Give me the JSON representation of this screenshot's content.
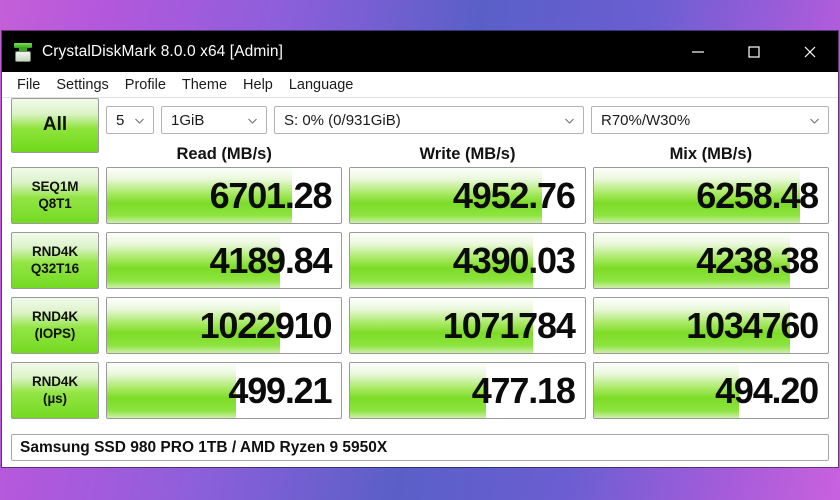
{
  "window": {
    "title": "CrystalDiskMark 8.0.0 x64 [Admin]",
    "icon": "crystaldiskmark-icon",
    "controls": {
      "minimize": "minimize-icon",
      "maximize": "maximize-icon",
      "close": "close-icon"
    }
  },
  "menubar": {
    "items": [
      {
        "label": "File"
      },
      {
        "label": "Settings"
      },
      {
        "label": "Profile"
      },
      {
        "label": "Theme"
      },
      {
        "label": "Help"
      },
      {
        "label": "Language"
      }
    ]
  },
  "toolbar": {
    "all_button": "All",
    "test_count": "5",
    "test_size": "1GiB",
    "drive": "S: 0% (0/931GiB)",
    "mix_ratio": "R70%/W30%"
  },
  "results": {
    "columns": [
      "Read (MB/s)",
      "Write (MB/s)",
      "Mix (MB/s)"
    ],
    "rows": [
      {
        "label_line1": "SEQ1M",
        "label_line2": "Q8T1",
        "read": {
          "value": "6701.28",
          "fill": 79
        },
        "write": {
          "value": "4952.76",
          "fill": 82
        },
        "mix": {
          "value": "6258.48",
          "fill": 88
        }
      },
      {
        "label_line1": "RND4K",
        "label_line2": "Q32T16",
        "read": {
          "value": "4189.84",
          "fill": 74
        },
        "write": {
          "value": "4390.03",
          "fill": 78
        },
        "mix": {
          "value": "4238.38",
          "fill": 84
        }
      },
      {
        "label_line1": "RND4K",
        "label_line2": "(IOPS)",
        "read": {
          "value": "1022910",
          "fill": 74
        },
        "write": {
          "value": "1071784",
          "fill": 78
        },
        "mix": {
          "value": "1034760",
          "fill": 84
        }
      },
      {
        "label_line1": "RND4K",
        "label_line2": "(µs)",
        "read": {
          "value": "499.21",
          "fill": 55
        },
        "write": {
          "value": "477.18",
          "fill": 58
        },
        "mix": {
          "value": "494.20",
          "fill": 62
        }
      }
    ]
  },
  "statusbar": {
    "text": "Samsung SSD 980 PRO 1TB / AMD Ryzen 9 5950X"
  },
  "colors": {
    "accent_green": "#7ddc28",
    "titlebar": "#000000",
    "desktop_gradient_start": "#c45fd8",
    "desktop_gradient_mid": "#5a5fc8",
    "desktop_gradient_end": "#c961de"
  }
}
